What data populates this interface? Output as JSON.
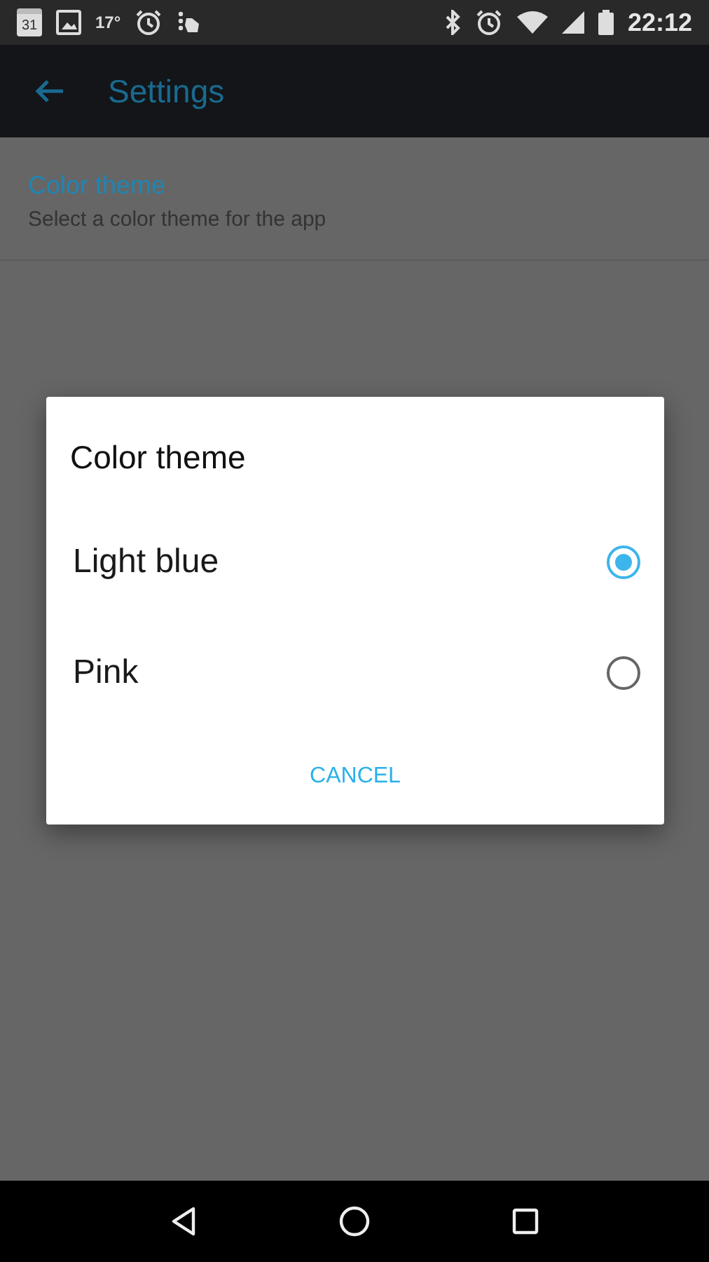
{
  "status_bar": {
    "calendar_day": "31",
    "temperature": "17°",
    "time": "22:12"
  },
  "toolbar": {
    "title": "Settings"
  },
  "preferences": [
    {
      "title": "Color theme",
      "summary": "Select a color theme for the app"
    }
  ],
  "dialog": {
    "title": "Color theme",
    "options": [
      {
        "label": "Light blue",
        "selected": true
      },
      {
        "label": "Pink",
        "selected": false
      }
    ],
    "buttons": [
      "CANCEL"
    ]
  }
}
